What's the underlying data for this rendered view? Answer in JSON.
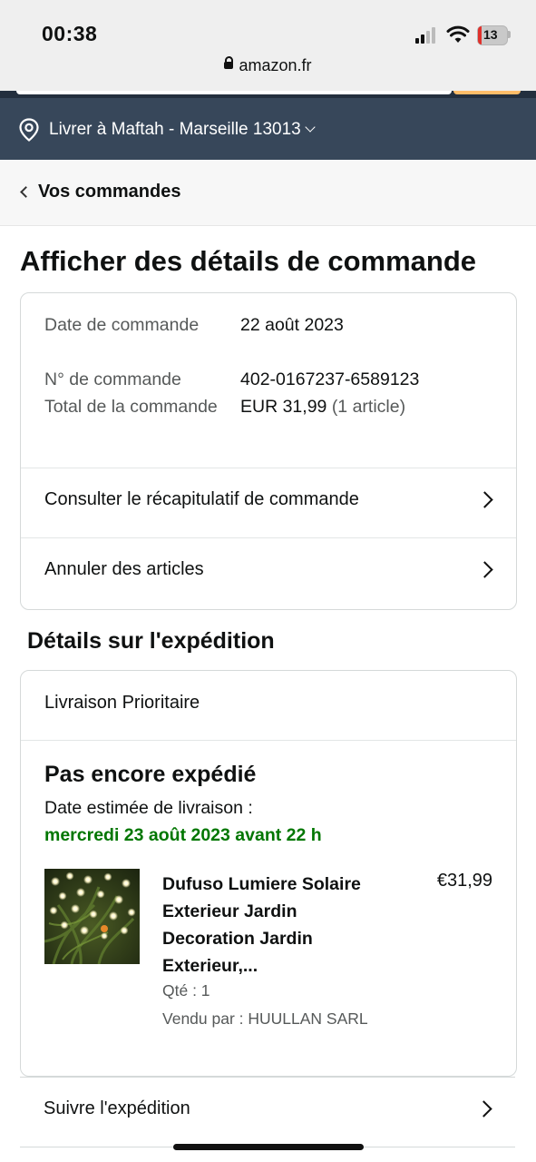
{
  "status_bar": {
    "time": "00:38",
    "battery_level": "13",
    "url": "amazon.fr"
  },
  "delivery_bar": {
    "text": "Livrer à Maftah - Marseille 13013"
  },
  "breadcrumb": {
    "label": "Vos commandes"
  },
  "page_title": "Afficher des détails de commande",
  "order_info": {
    "date_label": "Date de commande",
    "date_value": "22 août 2023",
    "number_label": "N° de commande",
    "number_value": "402-0167237-6589123",
    "total_label": "Total de la commande",
    "total_value": "EUR 31,99",
    "total_items": "(1 article)"
  },
  "order_links": {
    "summary": "Consulter le récapitulatif de commande",
    "cancel": "Annuler des articles"
  },
  "shipment": {
    "section_title": "Détails sur l'expédition",
    "method": "Livraison Prioritaire",
    "status": "Pas encore expédié",
    "estimate_label": "Date estimée de livraison :",
    "estimate_date": "mercredi 23 août 2023 avant 22 h",
    "product": {
      "title": "Dufuso Lumiere Solaire Exterieur Jardin Decoration Jardin Exterieur,...",
      "price": "€31,99",
      "quantity": "Qté : 1",
      "seller": "Vendu par : HUULLAN SARL"
    },
    "track_label": "Suivre l'expédition"
  },
  "colors": {
    "delivery_bar_bg": "#37475a",
    "estimate_green": "#007600",
    "orange_accent": "#febd69"
  }
}
